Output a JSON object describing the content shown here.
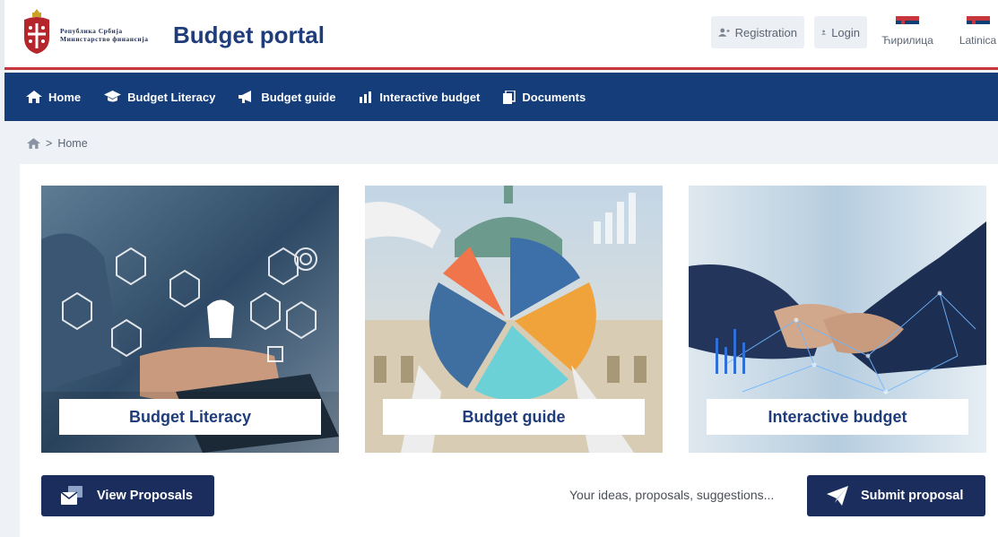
{
  "header": {
    "ministry_line1": "Република Србија",
    "ministry_line2": "Министарство финансија",
    "portal_title": "Budget portal",
    "registration_label": "Registration",
    "login_label": "Login",
    "lang_cyrillic": "Ћирилица",
    "lang_latin": "Latinica"
  },
  "nav": {
    "items": [
      {
        "label": "Home",
        "icon": "home-icon"
      },
      {
        "label": "Budget Literacy",
        "icon": "graduation-cap-icon"
      },
      {
        "label": "Budget guide",
        "icon": "megaphone-icon"
      },
      {
        "label": "Interactive budget",
        "icon": "chart-icon"
      },
      {
        "label": "Documents",
        "icon": "document-icon"
      }
    ]
  },
  "breadcrumb": {
    "separator": ">",
    "current": "Home"
  },
  "tiles": [
    {
      "label": "Budget Literacy"
    },
    {
      "label": "Budget guide"
    },
    {
      "label": "Interactive budget"
    }
  ],
  "actions": {
    "view_proposals": "View Proposals",
    "ideas_text": "Your ideas, proposals, suggestions...",
    "submit_proposal": "Submit proposal"
  },
  "colors": {
    "nav_bg": "#143d7a",
    "accent_red": "#c6363c",
    "button_dark": "#1b2d5c",
    "title_blue": "#1f3d7a"
  }
}
